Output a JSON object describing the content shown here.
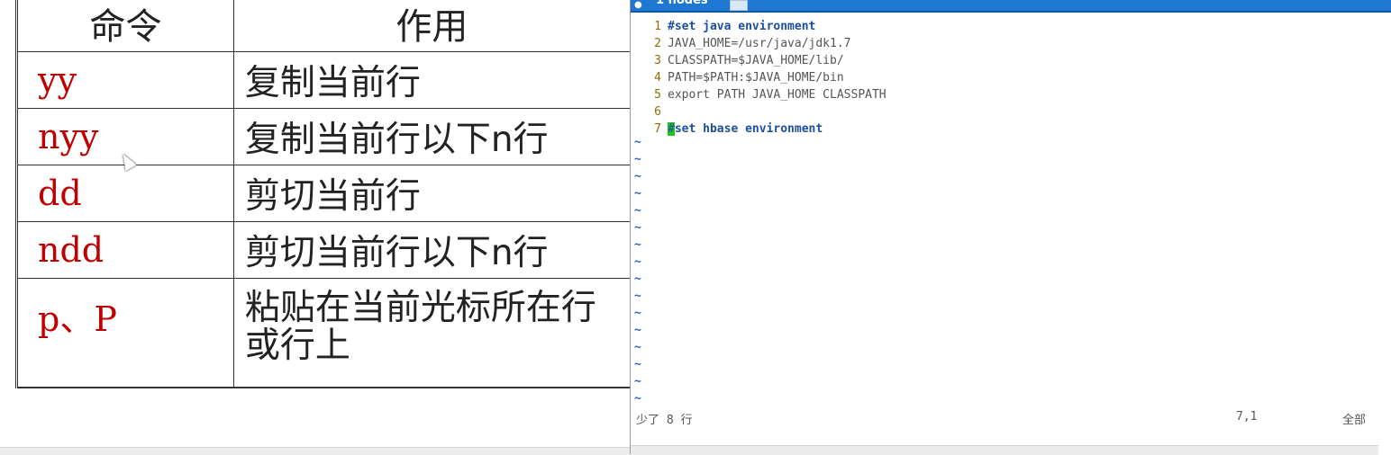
{
  "table": {
    "headers": [
      "命令",
      "作用"
    ],
    "rows": [
      {
        "cmd": "yy",
        "desc": "复制当前行"
      },
      {
        "cmd": "nyy",
        "desc": "复制当前行以下n行"
      },
      {
        "cmd": "dd",
        "desc": "剪切当前行"
      },
      {
        "cmd": "ndd",
        "desc": "剪切当前行以下n行"
      },
      {
        "cmd": "p、P",
        "desc": "粘贴在当前光标所在行",
        "desc2": "或行上"
      }
    ]
  },
  "editor": {
    "tab_label": "1 nodes",
    "lines": [
      {
        "n": "1",
        "text": "#set java environment"
      },
      {
        "n": "2",
        "text": "JAVA_HOME=/usr/java/jdk1.7"
      },
      {
        "n": "3",
        "text": "CLASSPATH=$JAVA_HOME/lib/"
      },
      {
        "n": "4",
        "text": "PATH=$PATH:$JAVA_HOME/bin"
      },
      {
        "n": "5",
        "text": "export PATH JAVA_HOME CLASSPATH"
      },
      {
        "n": "6",
        "text": ""
      },
      {
        "n": "7",
        "cursor_char": "#",
        "text": "set hbase environment"
      }
    ],
    "tilde_glyph": "~",
    "status_message": "少了 8 行",
    "cursor_position": "7,1",
    "scroll_percent": "全部",
    "colors": {
      "comment": "#1c4fa0",
      "cursor": "#22c222",
      "tabbar": "#1e78d2",
      "command_text": "#c00000"
    }
  }
}
